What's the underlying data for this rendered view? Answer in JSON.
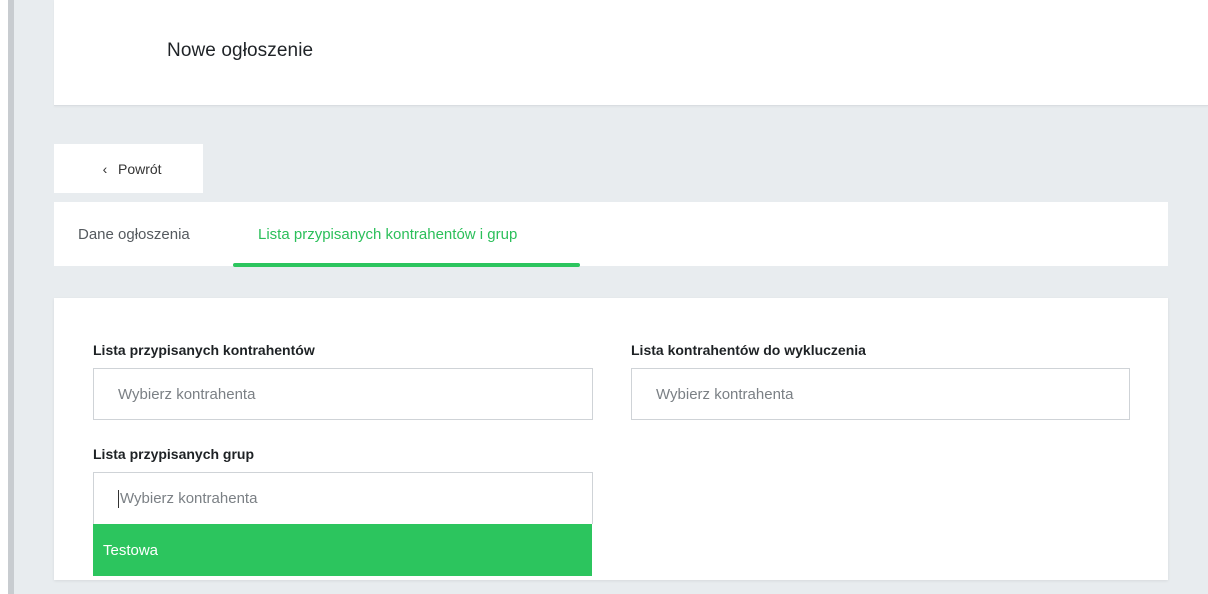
{
  "header": {
    "title": "Nowe ogłoszenie"
  },
  "back": {
    "icon": "chevron-left-icon",
    "label": "Powrót"
  },
  "tabs": [
    {
      "label": "Dane ogłoszenia",
      "active": false
    },
    {
      "label": "Lista przypisanych kontrahentów i grup",
      "active": true
    }
  ],
  "form": {
    "assigned_contractors": {
      "label": "Lista przypisanych kontrahentów",
      "placeholder": "Wybierz kontrahenta"
    },
    "excluded_contractors": {
      "label": "Lista kontrahentów do wykluczenia",
      "placeholder": "Wybierz kontrahenta"
    },
    "assigned_groups": {
      "label": "Lista przypisanych grup",
      "placeholder": "Wybierz kontrahenta",
      "options": [
        "Testowa"
      ]
    }
  },
  "colors": {
    "accent": "#2cc55e",
    "background": "#e8ecef"
  }
}
